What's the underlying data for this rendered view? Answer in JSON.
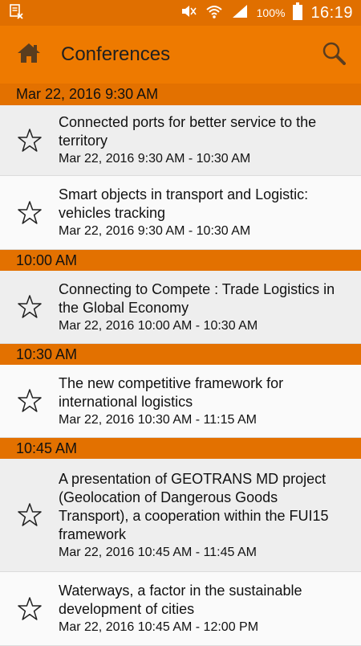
{
  "status_bar": {
    "battery_percent": "100%",
    "time": "16:19"
  },
  "app_bar": {
    "title": "Conferences",
    "home_icon": "home-icon",
    "search_icon": "search-icon"
  },
  "colors": {
    "app_bar": "#ee7a00",
    "section_header": "#e37100",
    "status_bar": "#e06f00"
  },
  "sections": [
    {
      "header": "Mar 22, 2016 9:30 AM",
      "items": [
        {
          "title": "Connected ports for better service to the territory",
          "time": "Mar 22, 2016 9:30 AM - 10:30 AM"
        },
        {
          "title": "Smart objects in transport and Logistic: vehicles tracking",
          "time": "Mar 22, 2016 9:30 AM - 10:30 AM"
        }
      ]
    },
    {
      "header": "10:00 AM",
      "items": [
        {
          "title": "Connecting to Compete : Trade Logistics in the Global Economy",
          "time": "Mar 22, 2016 10:00 AM - 10:30 AM"
        }
      ]
    },
    {
      "header": "10:30 AM",
      "items": [
        {
          "title": "The new competitive framework for international logistics",
          "time": "Mar 22, 2016 10:30 AM - 11:15 AM"
        }
      ]
    },
    {
      "header": "10:45 AM",
      "items": [
        {
          "title": "A presentation of GEOTRANS MD project (Geolocation of Dangerous Goods Transport), a cooperation within the FUI15 framework",
          "time": "Mar 22, 2016 10:45 AM - 11:45 AM"
        },
        {
          "title": "Waterways, a factor in the sustainable development of cities",
          "time": "Mar 22, 2016 10:45 AM - 12:00 PM"
        }
      ]
    }
  ]
}
